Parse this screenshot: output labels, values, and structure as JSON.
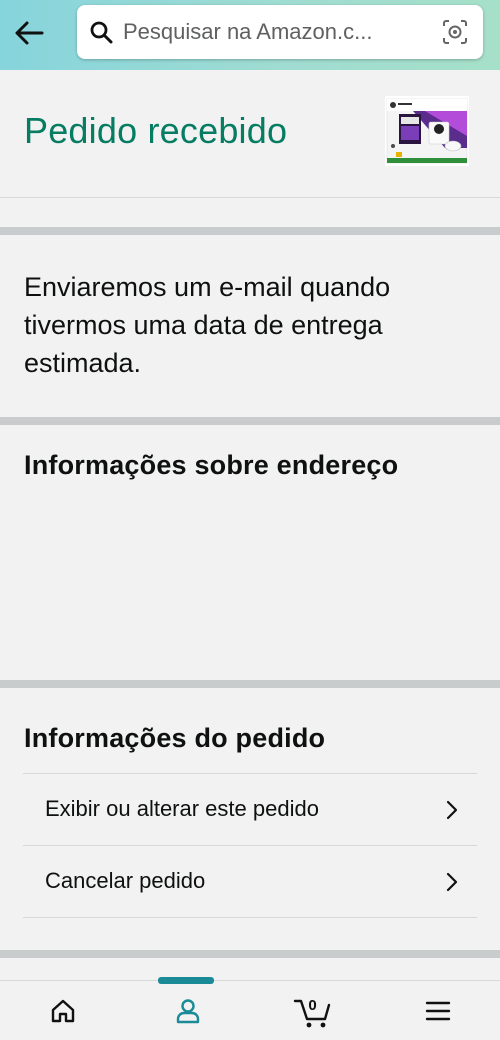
{
  "colors": {
    "title_teal": "#067d62",
    "active_tab": "#1a8a97",
    "header_gradient": [
      "#86d4dc",
      "#a6e0c9"
    ]
  },
  "search": {
    "placeholder": "Pesquisar na Amazon.c..."
  },
  "icons": {
    "back": "arrow-left-icon",
    "search": "search-icon",
    "camera": "camera-lens-icon",
    "home": "home-icon",
    "account": "person-icon",
    "cart": "cart-icon",
    "menu": "hamburger-menu-icon",
    "chevron": "chevron-right-icon"
  },
  "header": {
    "title": "Pedido recebido"
  },
  "message": {
    "text": "Enviaremos um e-mail quando tivermos uma data de entrega estimada."
  },
  "address_section": {
    "heading": "Informações sobre endereço"
  },
  "order_section": {
    "heading": "Informações do pedido",
    "rows": [
      {
        "label": "Exibir ou alterar este pedido"
      },
      {
        "label": "Cancelar pedido"
      }
    ]
  },
  "bottom_nav": {
    "active": "account",
    "cart_count": "0"
  }
}
